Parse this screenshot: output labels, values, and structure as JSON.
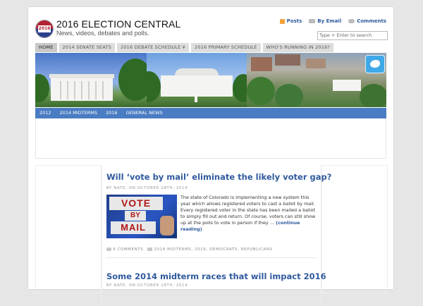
{
  "site": {
    "logo_year": "2016",
    "title": "2016 ELECTION CENTRAL",
    "tagline": "News, videos, debates and polls."
  },
  "subscribe": [
    {
      "label": "Posts",
      "icon": "rss-icon"
    },
    {
      "label": "By Email",
      "icon": "email-icon"
    },
    {
      "label": "Comments",
      "icon": "comments-icon"
    }
  ],
  "search": {
    "placeholder": "Type + Enter to search"
  },
  "top_nav": [
    {
      "label": "HOME",
      "active": true
    },
    {
      "label": "2014 SENATE SEATS"
    },
    {
      "label": "2016 DEBATE SCHEDULE ¥"
    },
    {
      "label": "2016 PRIMARY SCHEDULE"
    },
    {
      "label": "WHO'S RUNNING IN 2016?"
    }
  ],
  "sub_nav": [
    {
      "label": "2012"
    },
    {
      "label": "2014 MIDTERMS"
    },
    {
      "label": "2016"
    },
    {
      "label": "GENERAL NEWS"
    }
  ],
  "posts": [
    {
      "title": "Will ‘vote by mail’ eliminate the likely voter gap?",
      "meta": "BY NATE, ON OCTOBER 28TH, 2014",
      "thumb_words": [
        "VOTE",
        "BY",
        "MAIL"
      ],
      "excerpt": "The state of Colorado is implementing a new system this year which allows registered voters to cast a ballot by mail. Every registered voter in the state has been mailed a ballot to simply fill out and return. Of course, voters can still show up at the polls to vote in person if they … ",
      "more": "(continue reading)",
      "comments": "4 COMMENTS",
      "categories": "2014 MIDTERMS, 2016, DEMOCRATS, REPUBLICANS"
    },
    {
      "title": "Some 2014 midterm races that will impact 2016",
      "meta": "BY NATE, ON OCTOBER 28TH, 2014"
    }
  ],
  "colors": {
    "accent": "#2f5a9e",
    "subnav_bg": "#4a7cc3",
    "twitter": "#3fa9e8"
  }
}
